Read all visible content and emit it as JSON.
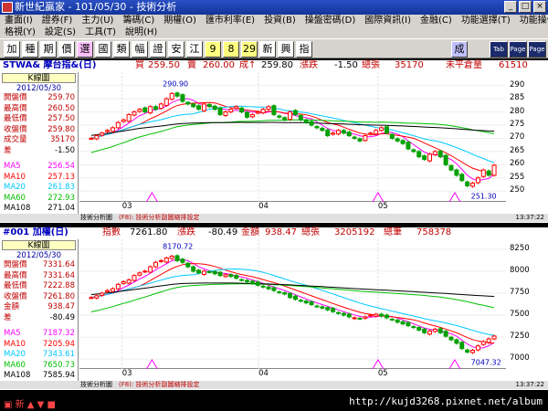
{
  "app": {
    "title": "新世紀贏家 - 101/05/30 - 技術分析"
  },
  "menu": {
    "row1": [
      "畫面(I)",
      "證券(F)",
      "主力(U)",
      "籌碼(C)",
      "期權(O)",
      "匯市利率(E)",
      "投資(B)",
      "操盤密碼(D)",
      "國際資訊(I)",
      "金融(C)",
      "功能選擇(T)",
      "功能操作(F)"
    ],
    "row2": [
      "格視(Y)",
      "設定(S)",
      "工具(T)",
      "說明(H)"
    ]
  },
  "toolbar": {
    "buttons": [
      "加",
      "種",
      "期",
      "價",
      "選",
      "國",
      "類",
      "幅",
      "證",
      "安",
      "江",
      "9",
      "8",
      "29",
      "新",
      "興",
      "指",
      "成"
    ],
    "icons": [
      "Tab",
      "Page Up",
      "Page Down"
    ]
  },
  "colors": {
    "ma5": "#ff00ff",
    "ma10": "#ff0000",
    "ma20": "#00c8ff",
    "ma60": "#00c000",
    "ma108": "#000000",
    "up": "#ff0000",
    "down": "#00a000"
  },
  "panels": [
    {
      "header": {
        "symbol": "STWA& 摩台指&(日)",
        "buy_label": "買",
        "buy": "259.50",
        "sell_label": "賣",
        "sell": "260.00",
        "deal_label": "成↑",
        "deal": "259.80",
        "chg_label": "漲跌",
        "chg": "-1.50",
        "vol_label": "總張",
        "vol": "35170",
        "oi_label": "未平倉量",
        "oi": "61510"
      },
      "side": {
        "chart_btn": "K線圖",
        "date": "2012/05/30",
        "rows": [
          [
            "開盤價",
            "259.70"
          ],
          [
            "最高價",
            "260.50"
          ],
          [
            "最低價",
            "257.50"
          ],
          [
            "收盤價",
            "259.80"
          ],
          [
            "成交量",
            "35170"
          ],
          [
            "差",
            "-1.50"
          ]
        ],
        "ma": [
          [
            "MA5",
            "256.54"
          ],
          [
            "MA10",
            "257.13"
          ],
          [
            "MA20",
            "261.83"
          ],
          [
            "MA60",
            "272.93"
          ],
          [
            "MA108",
            "271.04"
          ]
        ]
      },
      "yticks": [
        "290",
        "285",
        "280",
        "275",
        "270",
        "265",
        "260",
        "255",
        "250"
      ],
      "xlabels": [
        "03",
        "04",
        "05"
      ],
      "high_annot": "290.90",
      "low_annot": "251.30",
      "footer": {
        "left": "技術分析圖",
        "mid": "(F8): 技術分析副圖縮排設定",
        "time": "13:37:22"
      }
    },
    {
      "header": {
        "symbol": "#001 加權(日)",
        "idx_label": "指數",
        "idx": "7261.80",
        "chg_label": "漲跌",
        "chg": "-80.49",
        "amt_label": "金額",
        "amt": "938.47",
        "vol_label": "總張",
        "vol": "3205192",
        "cnt_label": "總筆",
        "cnt": "758378"
      },
      "side": {
        "chart_btn": "K線圖",
        "date": "2012/05/30",
        "rows": [
          [
            "開盤價",
            "7331.64"
          ],
          [
            "最高價",
            "7331.64"
          ],
          [
            "最低價",
            "7222.88"
          ],
          [
            "收盤價",
            "7261.80"
          ],
          [
            "金額",
            "938.47"
          ],
          [
            "差",
            "-80.49"
          ]
        ],
        "ma": [
          [
            "MA5",
            "7187.32"
          ],
          [
            "MA10",
            "7205.94"
          ],
          [
            "MA20",
            "7343.61"
          ],
          [
            "MA60",
            "7650.73"
          ],
          [
            "MA108",
            "7585.94"
          ]
        ]
      },
      "yticks": [
        "8250",
        "8000",
        "7750",
        "7500",
        "7250",
        "7000"
      ],
      "xlabels": [
        "03",
        "04",
        "05"
      ],
      "high_annot": "8170.72",
      "low_annot": "7047.32",
      "footer": {
        "left": "技術分析圖",
        "mid": "(F8): 技術分析副圖縮排設定",
        "time": "13:37:22"
      }
    }
  ],
  "chart_data": [
    {
      "type": "candlestick",
      "title": "STWA& 摩台指&(日)",
      "ylim": [
        248,
        293
      ],
      "series_lines": [
        "MA5",
        "MA10",
        "MA20",
        "MA60",
        "MA108"
      ],
      "closes": [
        270,
        271,
        272,
        273,
        274,
        276,
        277,
        279,
        280,
        281,
        280,
        282,
        281,
        283,
        285,
        287,
        286,
        284,
        283,
        282,
        281,
        283,
        282,
        281,
        279,
        280,
        281,
        282,
        280,
        278,
        279,
        280,
        281,
        282,
        279,
        278,
        277,
        280,
        279,
        277,
        276,
        275,
        274,
        273,
        271,
        272,
        273,
        272,
        271,
        270,
        269,
        271,
        272,
        273,
        274,
        272,
        270,
        269,
        268,
        266,
        265,
        263,
        262,
        264,
        265,
        263,
        260,
        258,
        256,
        254,
        252,
        253,
        255,
        258,
        256,
        259.8
      ]
    },
    {
      "type": "candlestick",
      "title": "#001 加權(日)",
      "ylim": [
        6950,
        8300
      ],
      "series_lines": [
        "MA5",
        "MA10",
        "MA20",
        "MA60",
        "MA108"
      ],
      "closes": [
        7700,
        7720,
        7750,
        7780,
        7800,
        7850,
        7880,
        7900,
        7950,
        7980,
        8000,
        8050,
        8100,
        8120,
        8150,
        8170,
        8120,
        8100,
        8050,
        8000,
        7980,
        8000,
        7990,
        7970,
        7950,
        7960,
        7940,
        7920,
        7900,
        7880,
        7860,
        7840,
        7820,
        7800,
        7780,
        7760,
        7740,
        7700,
        7680,
        7660,
        7640,
        7620,
        7600,
        7580,
        7560,
        7540,
        7520,
        7500,
        7480,
        7470,
        7460,
        7480,
        7500,
        7510,
        7490,
        7470,
        7450,
        7420,
        7400,
        7380,
        7360,
        7330,
        7300,
        7320,
        7340,
        7300,
        7260,
        7220,
        7180,
        7120,
        7080,
        7100,
        7150,
        7200,
        7230,
        7261.8
      ]
    }
  ]
}
